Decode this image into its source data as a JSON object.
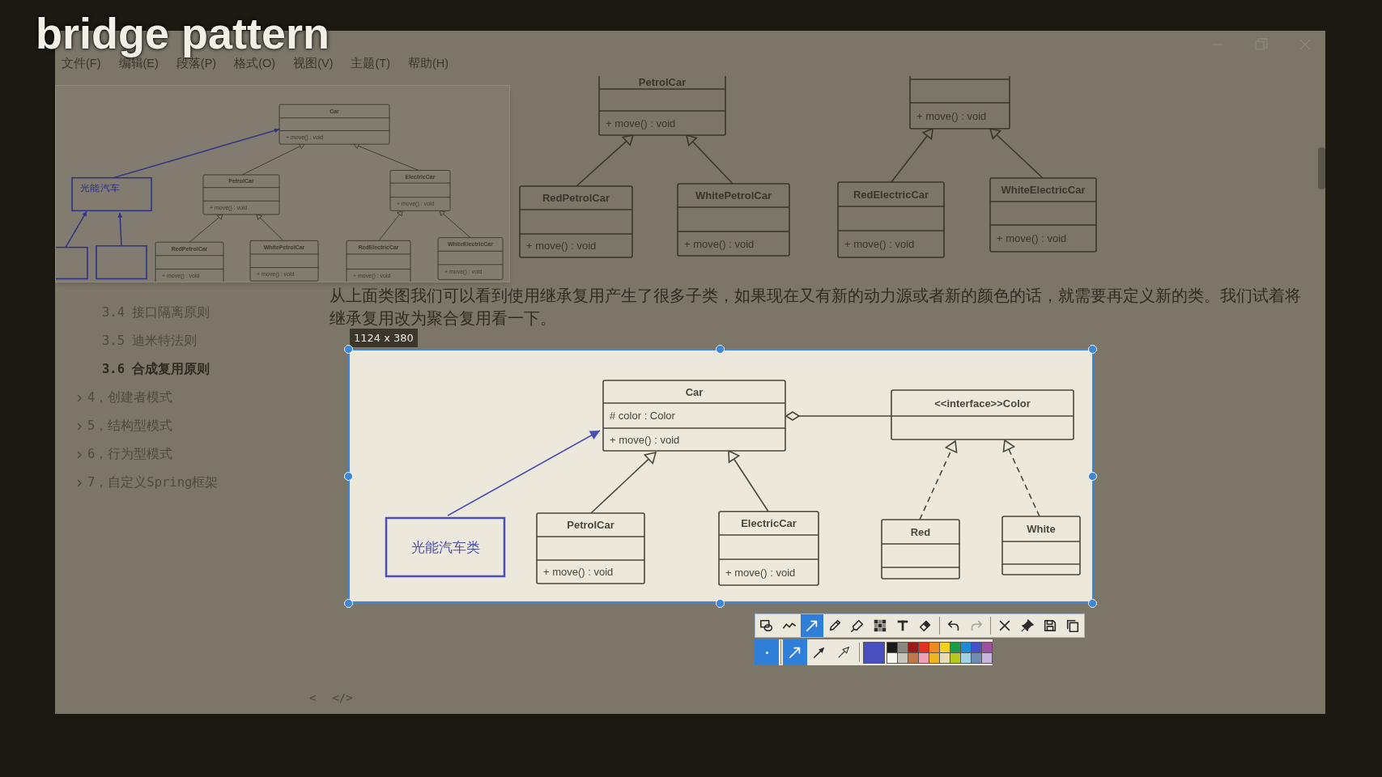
{
  "video_title": "bridge pattern",
  "menu": [
    "文件(F)",
    "编辑(E)",
    "段落(P)",
    "格式(O)",
    "视图(V)",
    "主题(T)",
    "帮助(H)"
  ],
  "sidebar": {
    "items": [
      {
        "kind": "section",
        "label": "3.4 接口隔离原则",
        "selected": false
      },
      {
        "kind": "section",
        "label": "3.5 迪米特法则",
        "selected": false
      },
      {
        "kind": "section",
        "label": "3.6 合成复用原则",
        "selected": true
      },
      {
        "kind": "chapter",
        "label": "4，创建者模式",
        "expanded": false,
        "selected": false
      },
      {
        "kind": "chapter",
        "label": "5，结构型模式",
        "expanded": false,
        "selected": false
      },
      {
        "kind": "chapter",
        "label": "6，行为型模式",
        "expanded": false,
        "selected": false
      },
      {
        "kind": "chapter",
        "label": "7，自定义Spring框架",
        "expanded": false,
        "selected": false
      }
    ]
  },
  "pinned_snapshot": {
    "classes": [
      {
        "kind": "class",
        "name": "Car",
        "method": "+ move() : void"
      },
      {
        "kind": "note",
        "name": "光能汽车"
      },
      {
        "kind": "class",
        "name": "PetrolCar",
        "method": "+ move() : void"
      },
      {
        "kind": "class",
        "name": "ElectricCar",
        "method": "+ move() : void"
      },
      {
        "kind": "class",
        "name": "RedPetrolCar",
        "method": "+ move() : void"
      },
      {
        "kind": "class",
        "name": "WhitePetrolCar",
        "method": "+ move() : void"
      },
      {
        "kind": "class",
        "name": "RedElectricCar",
        "method": "+ move() : void"
      },
      {
        "kind": "class",
        "name": "WhiteElectricCar",
        "method": "+ move() : void"
      },
      {
        "kind": "note"
      },
      {
        "kind": "note"
      }
    ]
  },
  "document": {
    "upper_diagram": {
      "classes": [
        {
          "kind": "class",
          "name": "PetrolCar",
          "method": "+ move() : void"
        },
        {
          "kind": "class",
          "method": "+ move() : void"
        },
        {
          "kind": "class",
          "name": "RedPetrolCar",
          "method": "+ move() : void"
        },
        {
          "kind": "class",
          "name": "WhitePetrolCar",
          "method": "+ move() : void"
        },
        {
          "kind": "class",
          "name": "RedElectricCar",
          "method": "+ move() : void"
        },
        {
          "kind": "class",
          "name": "WhiteElectricCar",
          "method": "+ move() : void"
        }
      ]
    },
    "paragraph": "从上面类图我们可以看到使用继承复用产生了很多子类，如果现在又有新的动力源或者新的颜色的话，就需要再定义新的类。我们试着将继承复用改为聚合复用看一下。",
    "footer_buttons": [
      "<",
      "</>"
    ]
  },
  "capture": {
    "size_label": "1124 x 380",
    "diagram": {
      "classes": [
        {
          "kind": "class",
          "name": "Car",
          "attribute": "# color : Color",
          "method": "+ move() : void"
        },
        {
          "kind": "class",
          "name": "<<interface>>Color"
        },
        {
          "kind": "note",
          "name": "光能汽车类"
        },
        {
          "kind": "class",
          "name": "PetrolCar",
          "method": "+ move() : void"
        },
        {
          "kind": "class",
          "name": "ElectricCar",
          "method": "+ move() : void"
        },
        {
          "kind": "class",
          "name": "Red"
        },
        {
          "kind": "class",
          "name": "White"
        }
      ]
    }
  },
  "toolbar": {
    "tools": [
      {
        "selected": false,
        "disabled": false
      },
      {
        "selected": false,
        "disabled": false
      },
      {
        "selected": true,
        "disabled": false
      },
      {
        "selected": false,
        "disabled": false
      },
      {
        "selected": false,
        "disabled": false
      },
      {
        "selected": false,
        "disabled": false
      },
      {
        "selected": false,
        "disabled": false
      },
      {
        "selected": false,
        "disabled": false
      },
      {
        "selected": false,
        "disabled": false
      },
      {
        "selected": false,
        "disabled": true
      },
      {
        "selected": false,
        "disabled": false
      },
      {
        "selected": false,
        "disabled": false
      },
      {
        "selected": false,
        "disabled": false
      },
      {
        "selected": false,
        "disabled": false
      }
    ],
    "options": [
      {
        "selected": true
      },
      {
        "selected": true
      },
      {
        "selected": false
      },
      {
        "selected": false
      }
    ],
    "current_swatch": {
      "color": "#4a4fc0"
    },
    "palette": [
      {
        "color": "#1a1a1a"
      },
      {
        "color": "#8a8680"
      },
      {
        "color": "#9b1b1b"
      },
      {
        "color": "#e0321e"
      },
      {
        "color": "#f08a1e"
      },
      {
        "color": "#f0d21e"
      },
      {
        "color": "#1e9b46"
      },
      {
        "color": "#1e8cd2"
      },
      {
        "color": "#4650c8"
      },
      {
        "color": "#a050a0"
      },
      {
        "color": "#f5f5f0"
      },
      {
        "color": "#c8c4bc"
      },
      {
        "color": "#c0784a"
      },
      {
        "color": "#f0a0b4"
      },
      {
        "color": "#f0b41e"
      },
      {
        "color": "#e6dcb4"
      },
      {
        "color": "#b4c81e"
      },
      {
        "color": "#a0d2e6"
      },
      {
        "color": "#6e8cb4"
      },
      {
        "color": "#c8b4dc"
      }
    ]
  }
}
